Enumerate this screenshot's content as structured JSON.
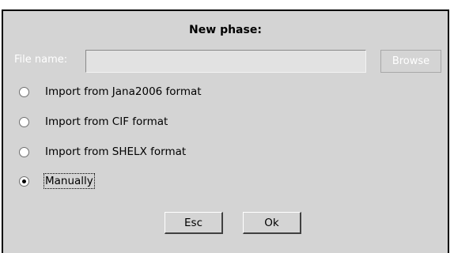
{
  "dialog": {
    "title": "New phase:",
    "file_label": "File name:",
    "file_value": "",
    "browse_label": "Browse",
    "options": [
      {
        "label": "Import from Jana2006 format",
        "checked": false
      },
      {
        "label": "Import from CIF format",
        "checked": false
      },
      {
        "label": "Import from SHELX format",
        "checked": false
      },
      {
        "label": "Manually",
        "checked": true
      }
    ],
    "esc_label": "Esc",
    "ok_label": "Ok"
  },
  "colors": {
    "dialog_bg": "#d4d4d4",
    "border": "#000000",
    "disabled_text": "#ffffff"
  }
}
